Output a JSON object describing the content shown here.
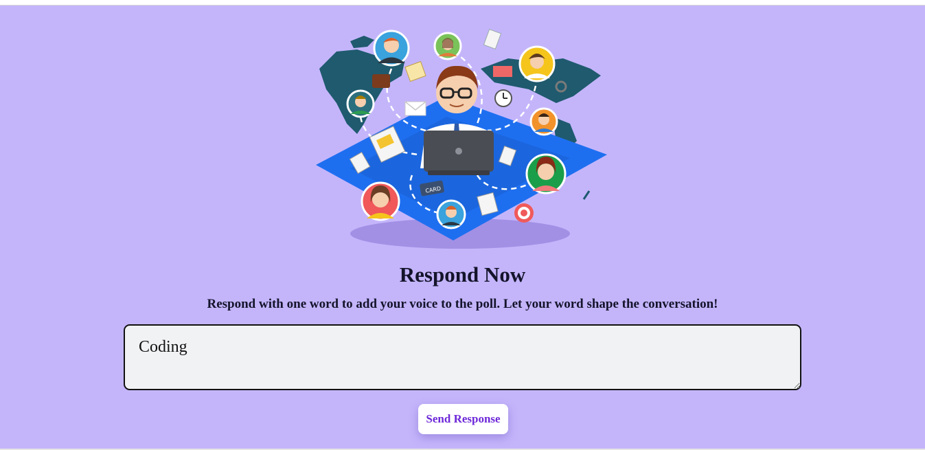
{
  "page": {
    "title": "Respond Now",
    "subtitle": "Respond with one word to add your voice to the poll. Let your word shape the conversation!"
  },
  "response": {
    "value": "Coding"
  },
  "send_button": {
    "label": "Send Response"
  },
  "colors": {
    "background": "#c4b5fb",
    "button_text": "#6d28d9",
    "input_background": "#f1f2f4",
    "map_land": "#1f5a6e",
    "map_platform": "#1e6ff0"
  },
  "illustration": {
    "icon": "remote-worker-network-illustration",
    "card_label": "CARD"
  }
}
